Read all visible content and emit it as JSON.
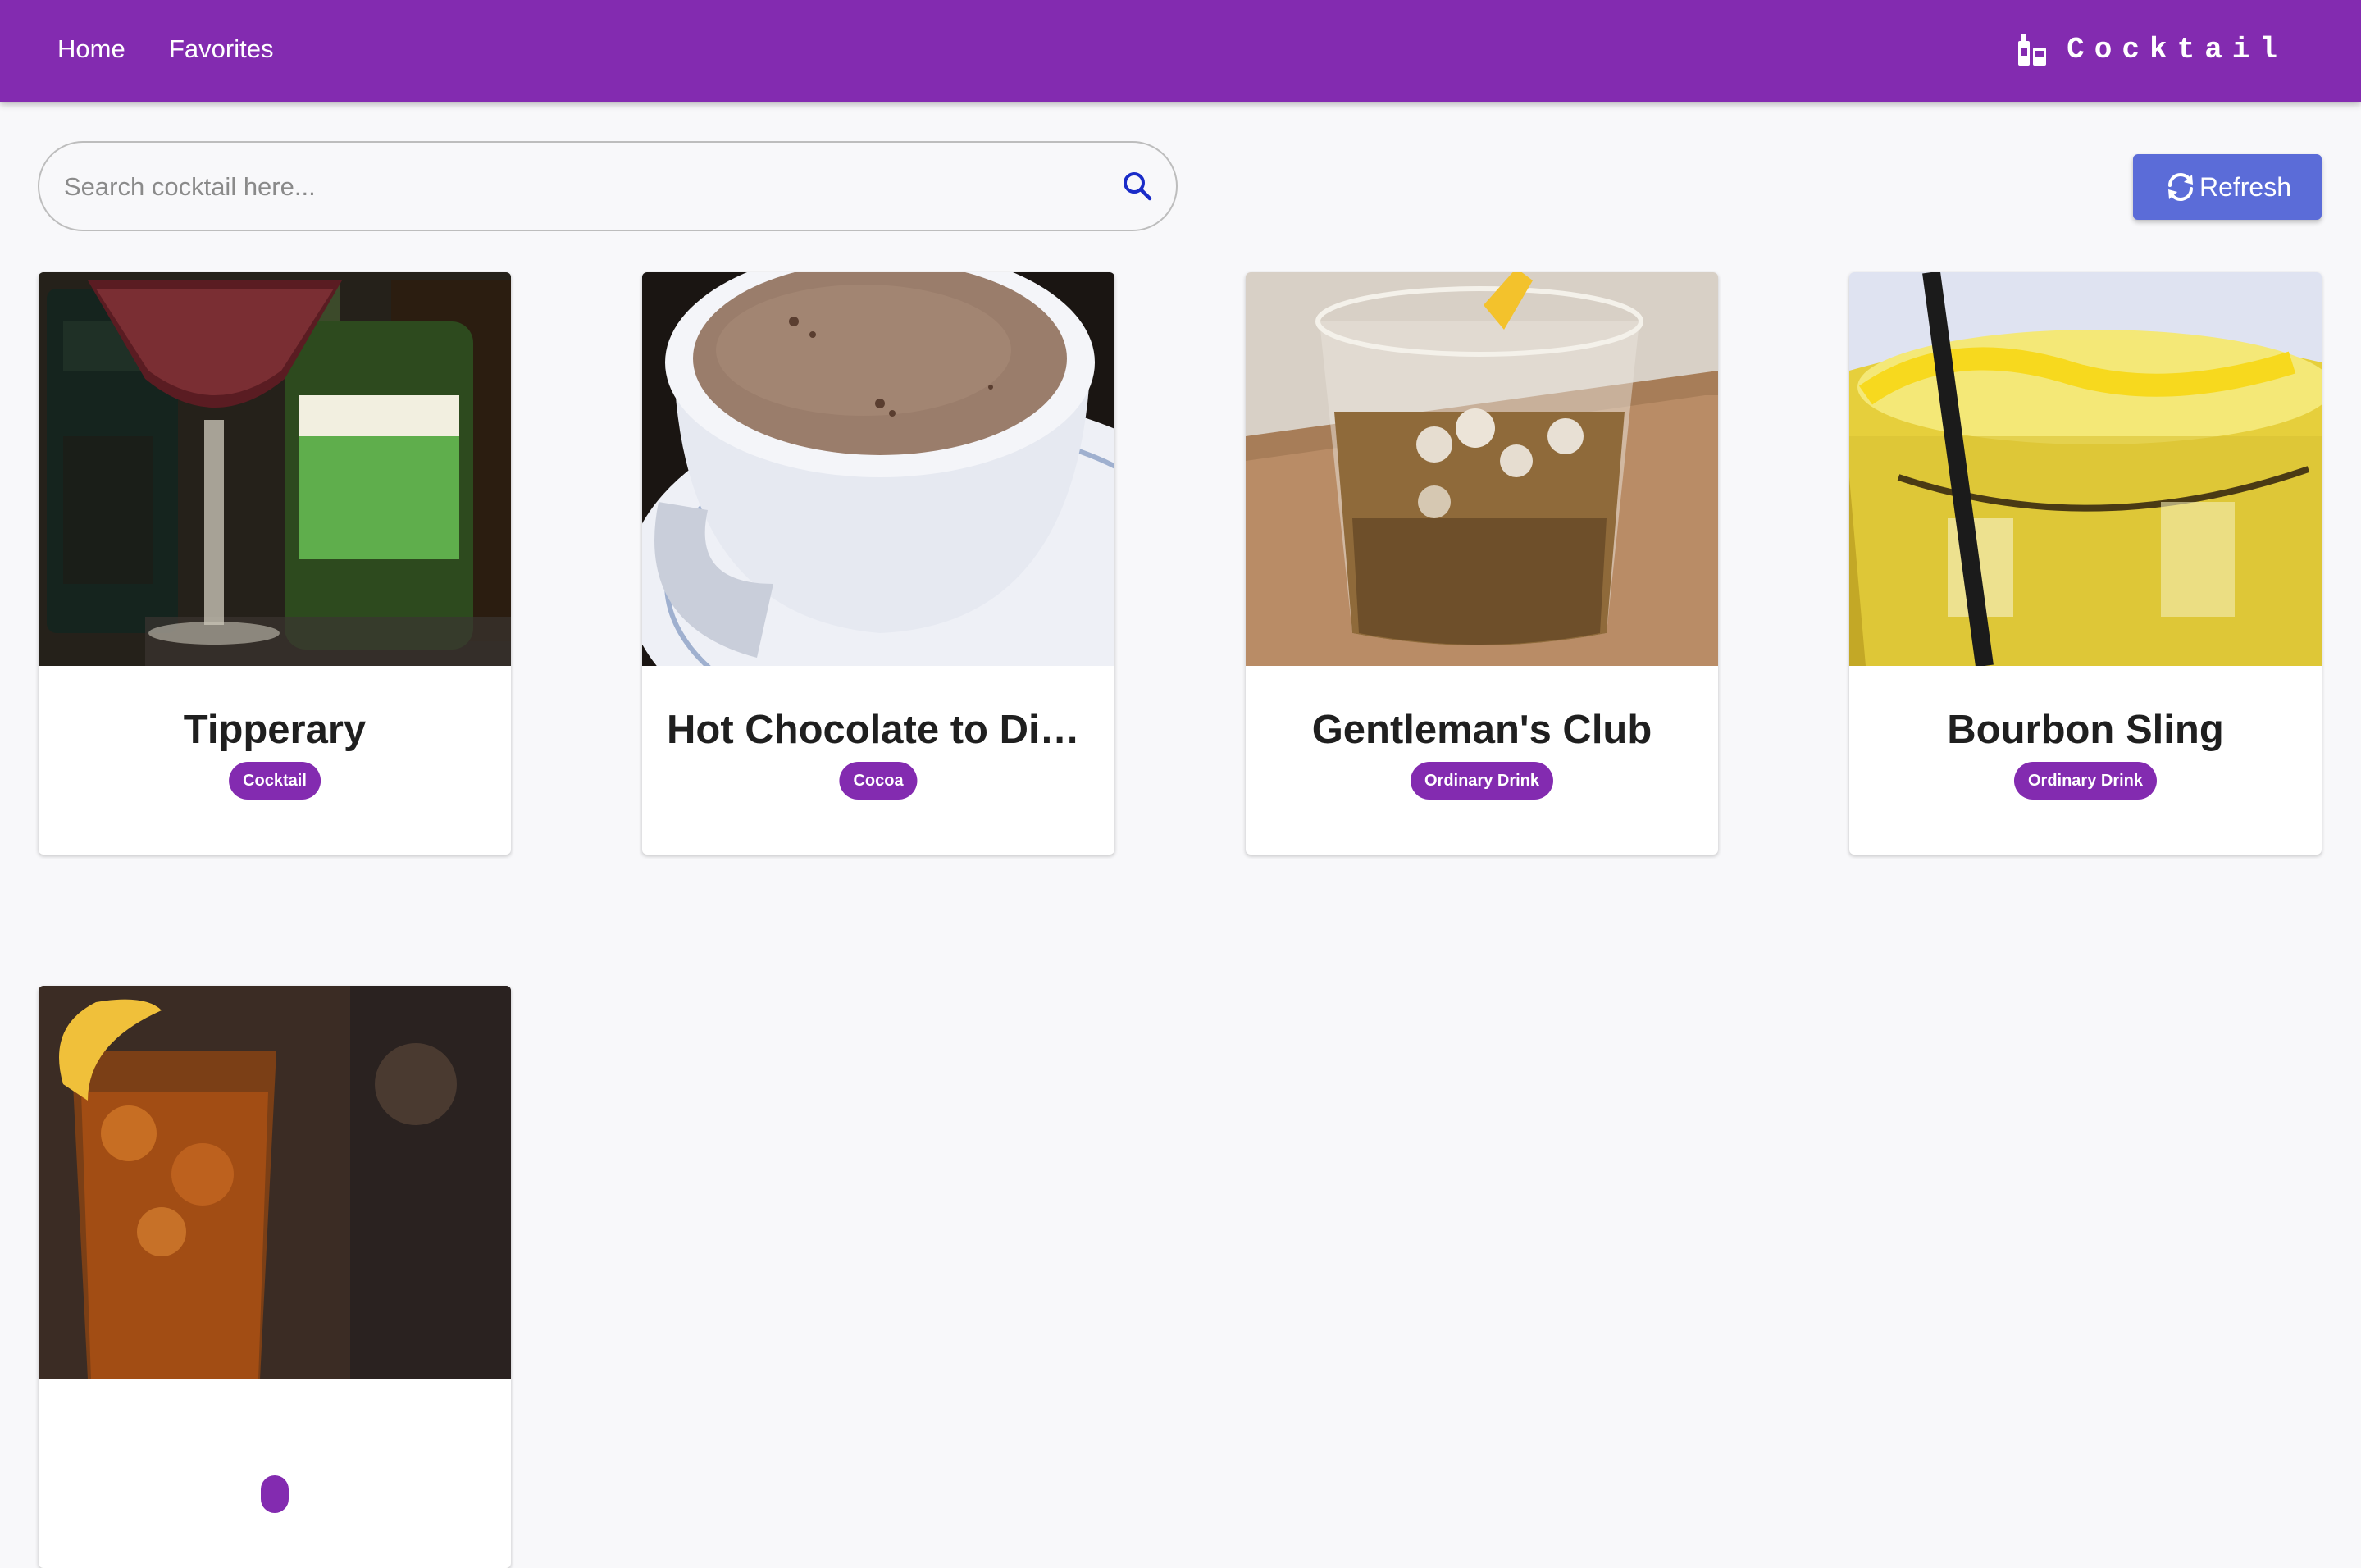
{
  "appbar": {
    "nav": [
      {
        "label": "Home"
      },
      {
        "label": "Favorites"
      }
    ],
    "brand": {
      "text": "Cocktail",
      "icon": "bottle-glass-icon"
    }
  },
  "search": {
    "placeholder": "Search cocktail here...",
    "value": "",
    "icon": "search-icon"
  },
  "refresh": {
    "label": "Refresh",
    "icon": "refresh-icon"
  },
  "colors": {
    "primary": "#832bb0",
    "refresh_button": "#5b6cd8",
    "background": "#f8f8fa"
  },
  "drinks": [
    {
      "name": "Tipperary",
      "category": "Cocktail"
    },
    {
      "name": "Hot Chocolate to Die for",
      "category": "Cocoa"
    },
    {
      "name": "Gentleman's Club",
      "category": "Ordinary Drink"
    },
    {
      "name": "Bourbon Sling",
      "category": "Ordinary Drink"
    },
    {
      "name": "",
      "category": ""
    }
  ]
}
